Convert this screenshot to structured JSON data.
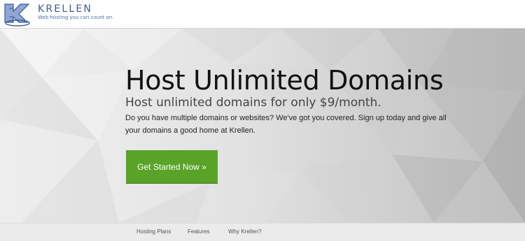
{
  "brand": {
    "name": "KRELLEN",
    "tagline": "Web hosting you can count on."
  },
  "hero": {
    "headline": "Host Unlimited Domains",
    "subheadline": "Host unlimited domains for only $9/month.",
    "description": "Do you have multiple domains or websites? We've got you covered. Sign up today and give all your domains a good home at Krellen.",
    "cta_label": "Get Started Now »"
  },
  "subnav": {
    "items": [
      "Hosting Plans",
      "Features",
      "Why Krellen?"
    ]
  },
  "colors": {
    "brand_blue": "#3c5a99",
    "cta_green": "#5aa329"
  }
}
